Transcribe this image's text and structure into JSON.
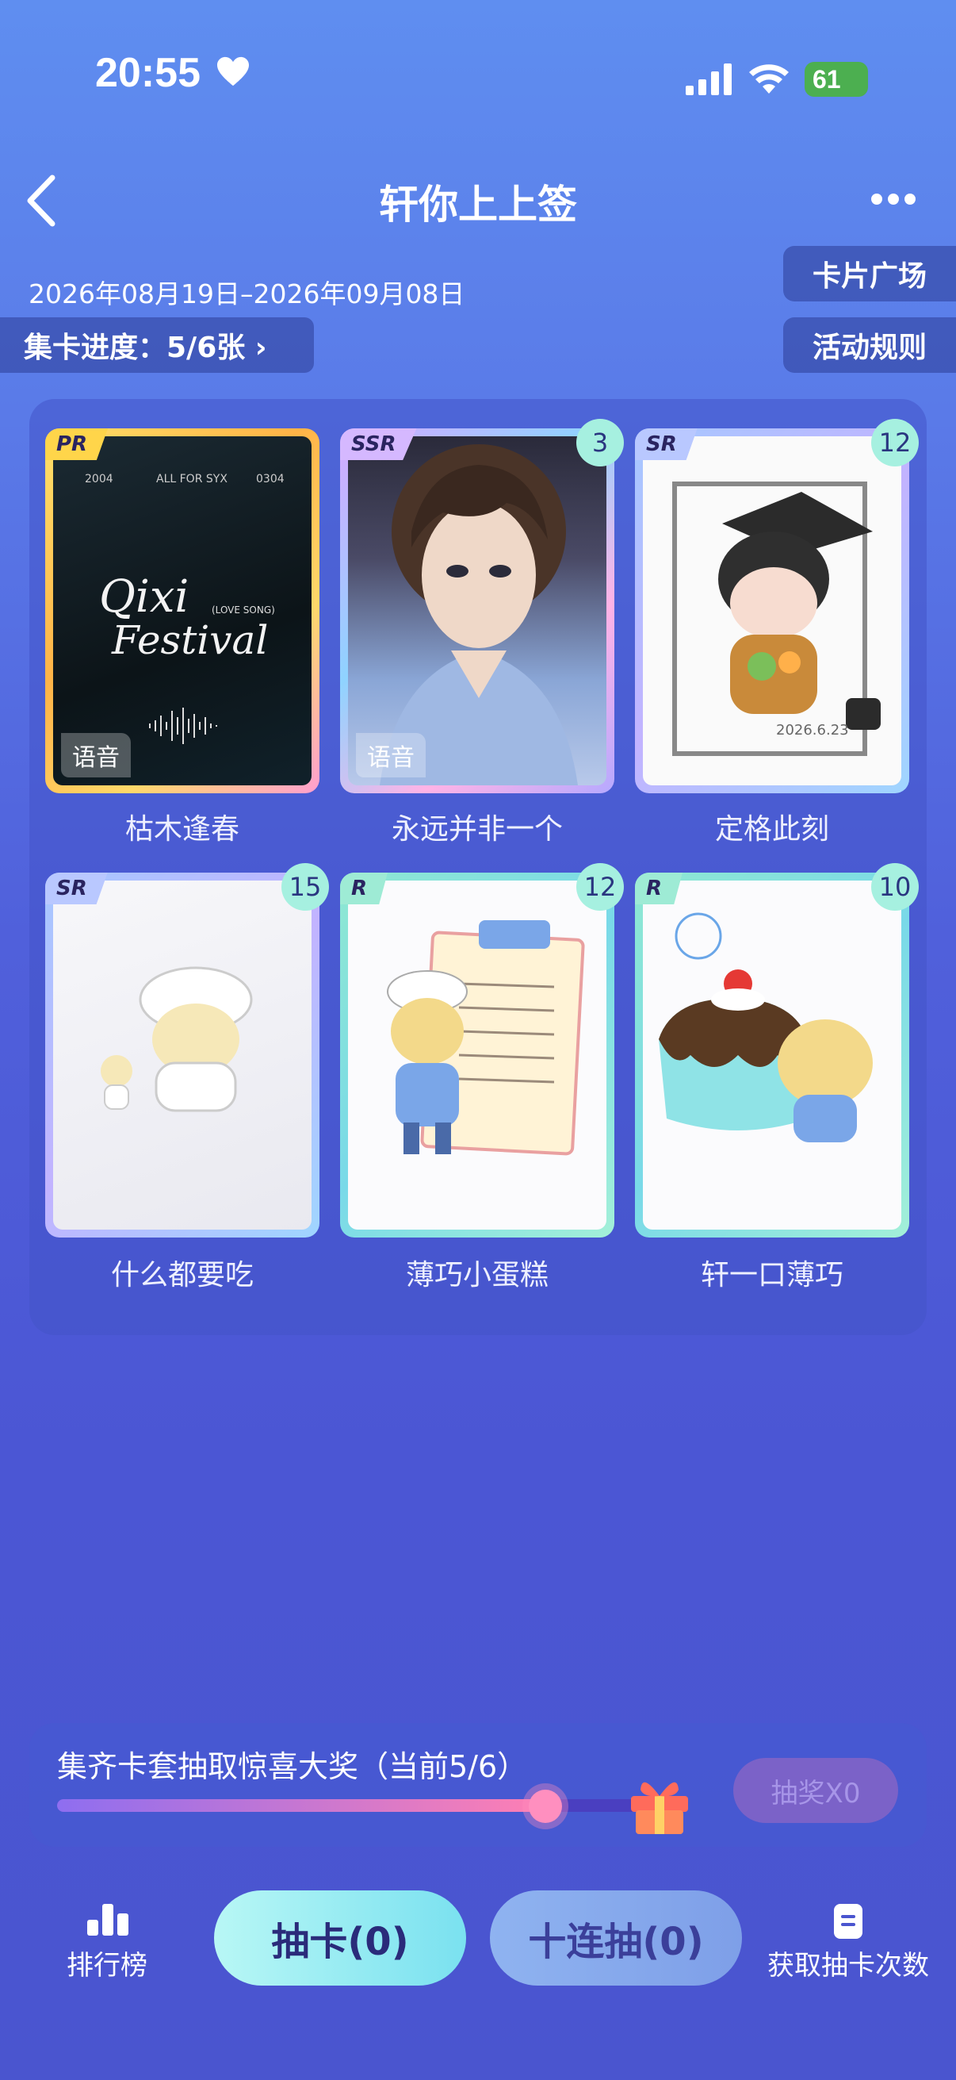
{
  "status_bar": {
    "time": "20:55",
    "battery": "61"
  },
  "nav": {
    "title": "轩你上上签"
  },
  "header": {
    "date_range": "2026年08月19日–2026年09月08日",
    "card_square": "卡片广场",
    "activity_rules": "活动规则",
    "progress": "集卡进度：5/6张 ›"
  },
  "cards": [
    {
      "rarity": "PR",
      "name": "枯木逢春",
      "voice": "语音",
      "count": ""
    },
    {
      "rarity": "SSR",
      "name": "永远并非一个",
      "voice": "语音",
      "count": "3"
    },
    {
      "rarity": "SR",
      "name": "定格此刻",
      "voice": "",
      "count": "12"
    },
    {
      "rarity": "SR",
      "name": "什么都要吃",
      "voice": "",
      "count": "15"
    },
    {
      "rarity": "R",
      "name": "薄巧小蛋糕",
      "voice": "",
      "count": "12"
    },
    {
      "rarity": "R",
      "name": "轩一口薄巧",
      "voice": "",
      "count": "10"
    }
  ],
  "card_art_text": {
    "pr_top_left": "2004",
    "pr_top_mid": "ALL FOR SYX",
    "pr_top_right": "0304",
    "pr_title_1": "Qixi",
    "pr_title_2": "Festival",
    "pr_sub": "(LOVE SONG)",
    "sr_date": "2026.6.23"
  },
  "prize": {
    "text": "集齐卡套抽取惊喜大奖（当前5/6）",
    "progress_fraction": 0.833,
    "draw_label": "抽奖X0"
  },
  "bottom": {
    "rank_label": "排行榜",
    "draw_label": "抽卡(0)",
    "ten_draw_label": "十连抽(0)",
    "get_draws_label": "获取抽卡次数"
  },
  "icons": [
    "heart-icon",
    "signal-icon",
    "wifi-icon",
    "battery-icon",
    "back-icon",
    "more-icon",
    "gift-icon",
    "rank-icon",
    "document-icon"
  ],
  "colors": {
    "accent": "#a6f0e0",
    "pink": "#ff7fb3",
    "background": "#4b56d4"
  }
}
